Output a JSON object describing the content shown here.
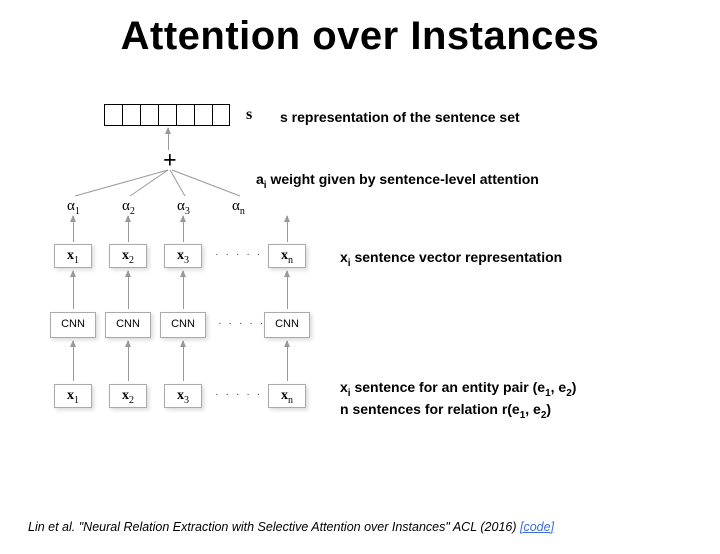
{
  "title": "Attention over Instances",
  "s_label": "s",
  "alpha": {
    "a1": "α",
    "a2": "α",
    "a3": "α",
    "an": "α",
    "s1": "1",
    "s2": "2",
    "s3": "3",
    "sn": "n"
  },
  "x": {
    "x": "x",
    "s1": "1",
    "s2": "2",
    "s3": "3",
    "sn": "n"
  },
  "cnn": "CNN",
  "dots": "· · · · · ·",
  "annot": {
    "s": {
      "v": "s",
      "t": " representation of the sentence set"
    },
    "a": {
      "v": "a",
      "sub": "i",
      "t": " weight given by sentence-level attention"
    },
    "xi": {
      "v": "x",
      "sub": "i",
      "t": " sentence vector representation"
    },
    "pair": {
      "v": "x",
      "sub": "i",
      "l1a": " sentence for an entity pair (e",
      "l1b": ", e",
      "l1c": ")",
      "l2a": "n sentences for relation r(e",
      "l2b": ", e",
      "l2c": ")",
      "e1": "1",
      "e2": "2"
    }
  },
  "cite": {
    "text": "Lin et al. \"Neural Relation Extraction with Selective Attention over Instances\" ACL (2016) ",
    "link": "[code]"
  }
}
